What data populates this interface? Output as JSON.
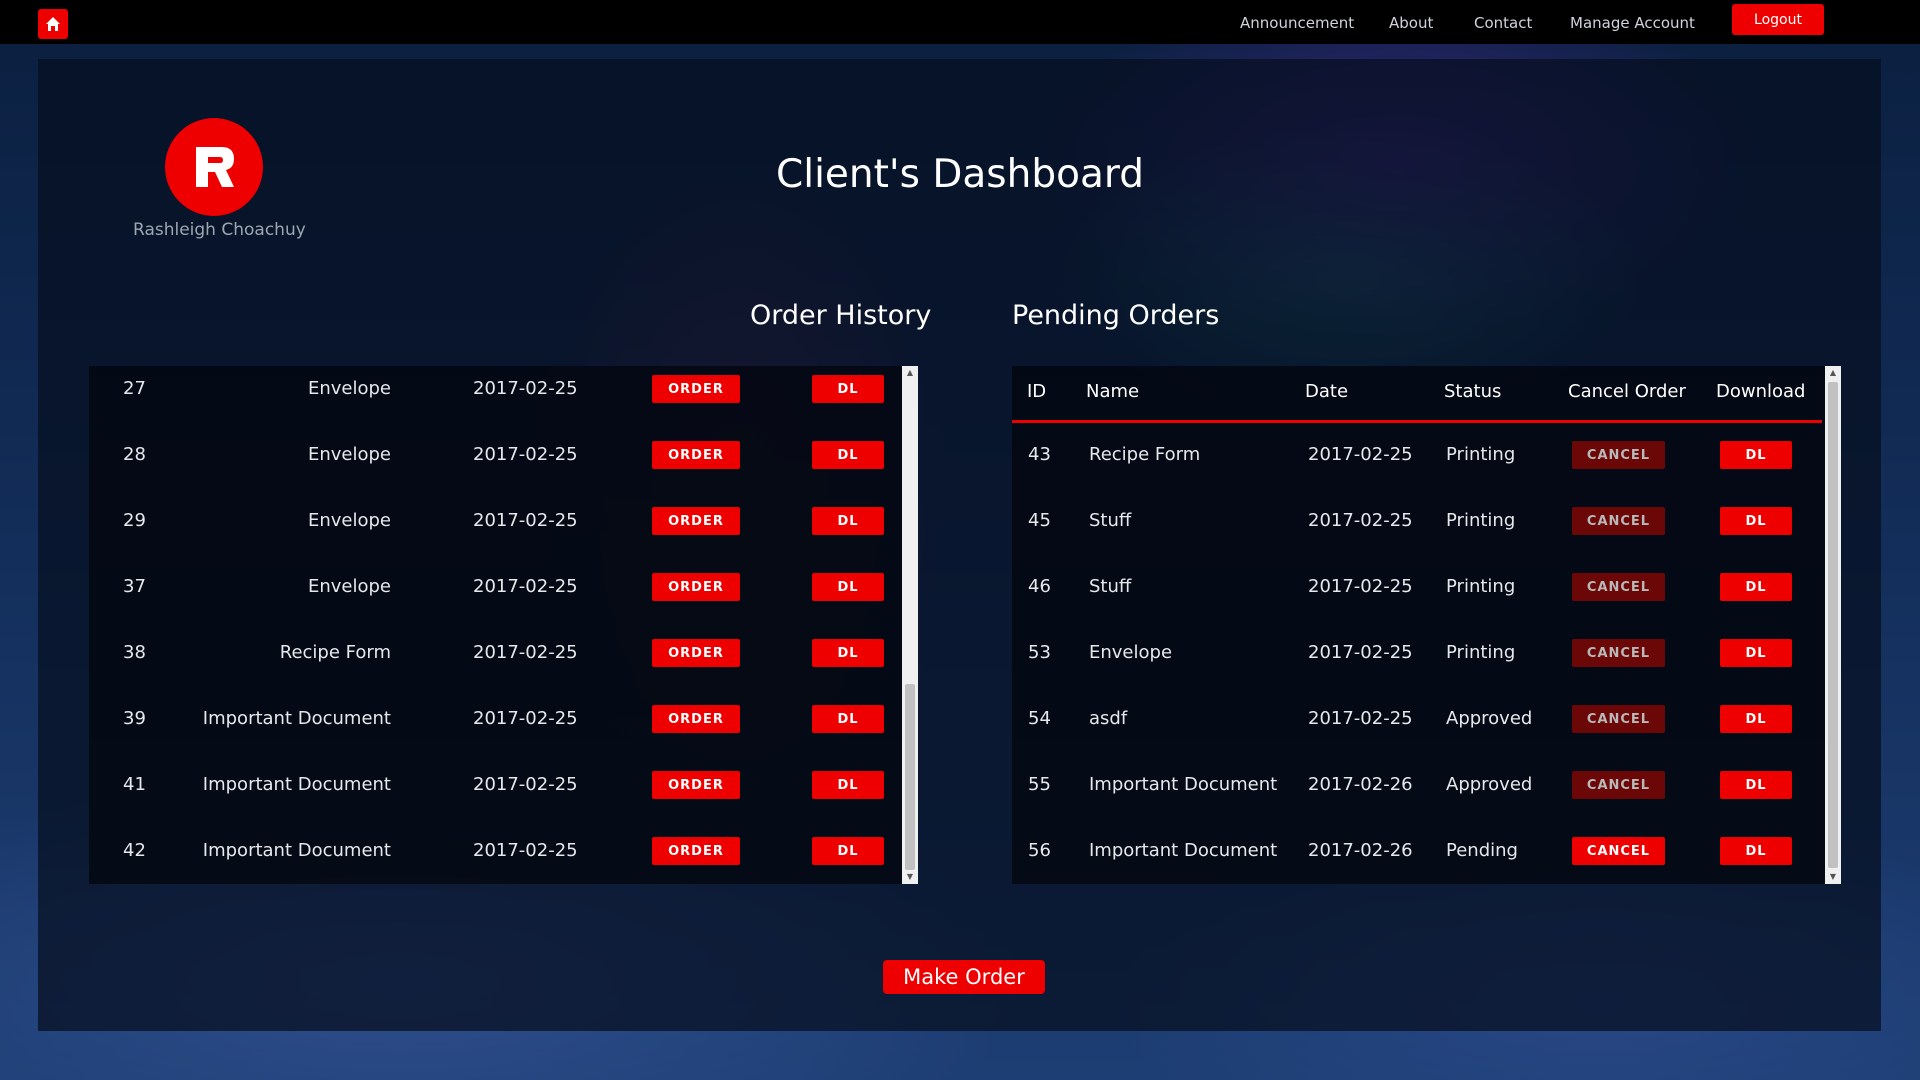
{
  "nav": {
    "links": [
      "Announcement",
      "About",
      "Contact",
      "Manage Account"
    ],
    "logout_label": "Logout"
  },
  "profile": {
    "name": "Rashleigh Choachuy"
  },
  "page_title": "Client's Dashboard",
  "order_history": {
    "title": "Order History",
    "order_label": "ORDER",
    "dl_label": "DL",
    "rows": [
      {
        "id": "27",
        "name": "Envelope",
        "date": "2017-02-25"
      },
      {
        "id": "28",
        "name": "Envelope",
        "date": "2017-02-25"
      },
      {
        "id": "29",
        "name": "Envelope",
        "date": "2017-02-25"
      },
      {
        "id": "37",
        "name": "Envelope",
        "date": "2017-02-25"
      },
      {
        "id": "38",
        "name": "Recipe Form",
        "date": "2017-02-25"
      },
      {
        "id": "39",
        "name": "Important Document",
        "date": "2017-02-25"
      },
      {
        "id": "41",
        "name": "Important Document",
        "date": "2017-02-25"
      },
      {
        "id": "42",
        "name": "Important Document",
        "date": "2017-02-25"
      }
    ]
  },
  "pending_orders": {
    "title": "Pending Orders",
    "headers": [
      "ID",
      "Name",
      "Date",
      "Status",
      "Cancel Order",
      "Download"
    ],
    "cancel_label": "CANCEL",
    "dl_label": "DL",
    "rows": [
      {
        "id": "43",
        "name": "Recipe Form",
        "date": "2017-02-25",
        "status": "Printing",
        "cancel_enabled": false
      },
      {
        "id": "45",
        "name": "Stuff",
        "date": "2017-02-25",
        "status": "Printing",
        "cancel_enabled": false
      },
      {
        "id": "46",
        "name": "Stuff",
        "date": "2017-02-25",
        "status": "Printing",
        "cancel_enabled": false
      },
      {
        "id": "53",
        "name": "Envelope",
        "date": "2017-02-25",
        "status": "Printing",
        "cancel_enabled": false
      },
      {
        "id": "54",
        "name": "asdf",
        "date": "2017-02-25",
        "status": "Approved",
        "cancel_enabled": false
      },
      {
        "id": "55",
        "name": "Important Document",
        "date": "2017-02-26",
        "status": "Approved",
        "cancel_enabled": false
      },
      {
        "id": "56",
        "name": "Important Document",
        "date": "2017-02-26",
        "status": "Pending",
        "cancel_enabled": true
      }
    ]
  },
  "make_order_label": "Make Order",
  "colors": {
    "accent": "#ee0000",
    "accent_dim": "#6b0707",
    "panel": "#060e1e"
  },
  "icons": {
    "home": "home-icon",
    "logo": "r-logo-icon"
  }
}
